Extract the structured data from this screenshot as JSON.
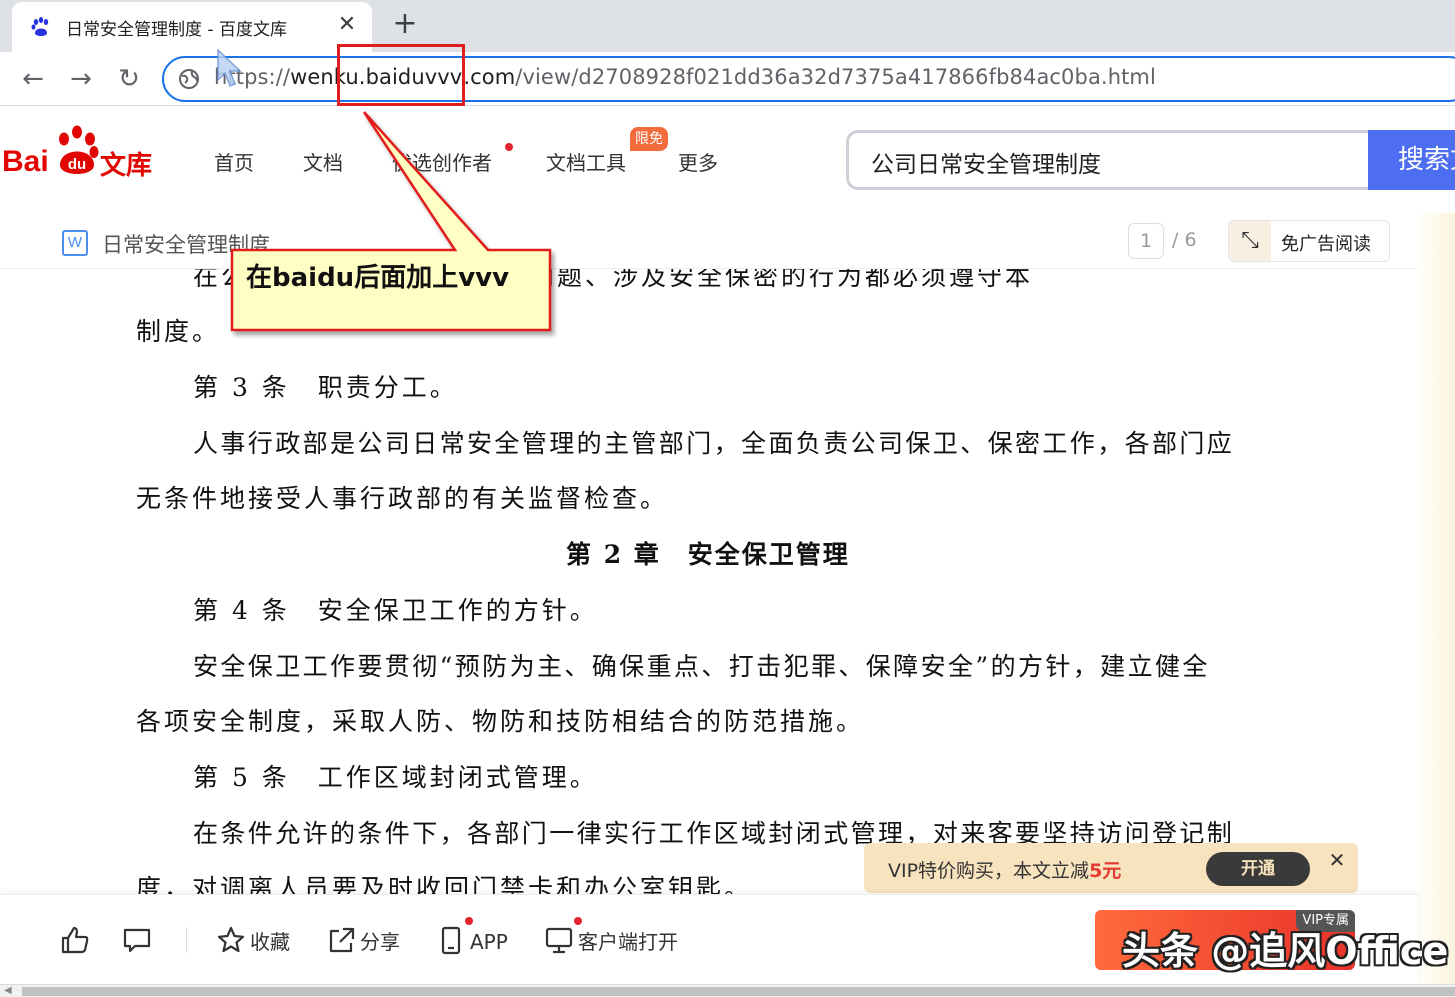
{
  "browser": {
    "tab_title": "日常安全管理制度 - 百度文库",
    "tab_close": "✕",
    "new_tab": "+",
    "back_icon": "←",
    "forward_icon": "→",
    "reload_icon": "↻",
    "url_scheme": "https://",
    "url_host": "wenku.baiduvvv.com",
    "url_path": "/view/d2708928f021dd36a32d7375a417866fb84ac0ba.html"
  },
  "site": {
    "logo_bai": "Bai",
    "logo_du": "du",
    "logo_wenku": "文库",
    "nav": [
      {
        "label": "首页"
      },
      {
        "label": "文档"
      },
      {
        "label": "优选创作者"
      },
      {
        "label": "文档工具"
      },
      {
        "label": "更多"
      }
    ],
    "tools_badge": "限免",
    "search_value": "公司日常安全管理制度",
    "search_button": "搜索文档"
  },
  "docbar": {
    "doc_icon": "W",
    "title": "日常安全管理制度",
    "page_current": "1",
    "page_total": "/ 6",
    "noad_label": "免广告阅读"
  },
  "document": {
    "lines": [
      "在公司内部涉及安全保卫的问题、涉及安全保密的行为都必须遵守本",
      "制度。",
      "第 3 条　职责分工。",
      "人事行政部是公司日常安全管理的主管部门，全面负责公司保卫、保密工作，各部门应",
      "无条件地接受人事行政部的有关监督检查。",
      "第 2 章　安全保卫管理",
      "第 4 条　安全保卫工作的方针。",
      "安全保卫工作要贯彻“预防为主、确保重点、打击犯罪、保障安全”的方针，建立健全",
      "各项安全制度，采取人防、物防和技防相结合的防范措施。",
      "第 5 条　工作区域封闭式管理。",
      "在条件允许的条件下，各部门一律实行工作区域封闭式管理，对来客要坚持访问登记制",
      "度，对调离人员要及时收回门禁卡和办公室钥匙。"
    ]
  },
  "vip_popup": {
    "text": "VIP特价购买，本文立减",
    "amount": "5元",
    "open": "开通",
    "close": "✕"
  },
  "bottom": {
    "collect": "收藏",
    "share": "分享",
    "app": "APP",
    "client": "客户端打开",
    "vip_tag": "VIP专属"
  },
  "annotation": {
    "callout": "在baidu后面加上vvv"
  },
  "watermark": "头条 @追风Office",
  "colors": {
    "baidu_red": "#e10602",
    "search_blue": "#4e6ef2",
    "omnibox_focus": "#1a73e8",
    "callout_fill": "#ffffc4",
    "highlight_red": "#e01e1e"
  }
}
